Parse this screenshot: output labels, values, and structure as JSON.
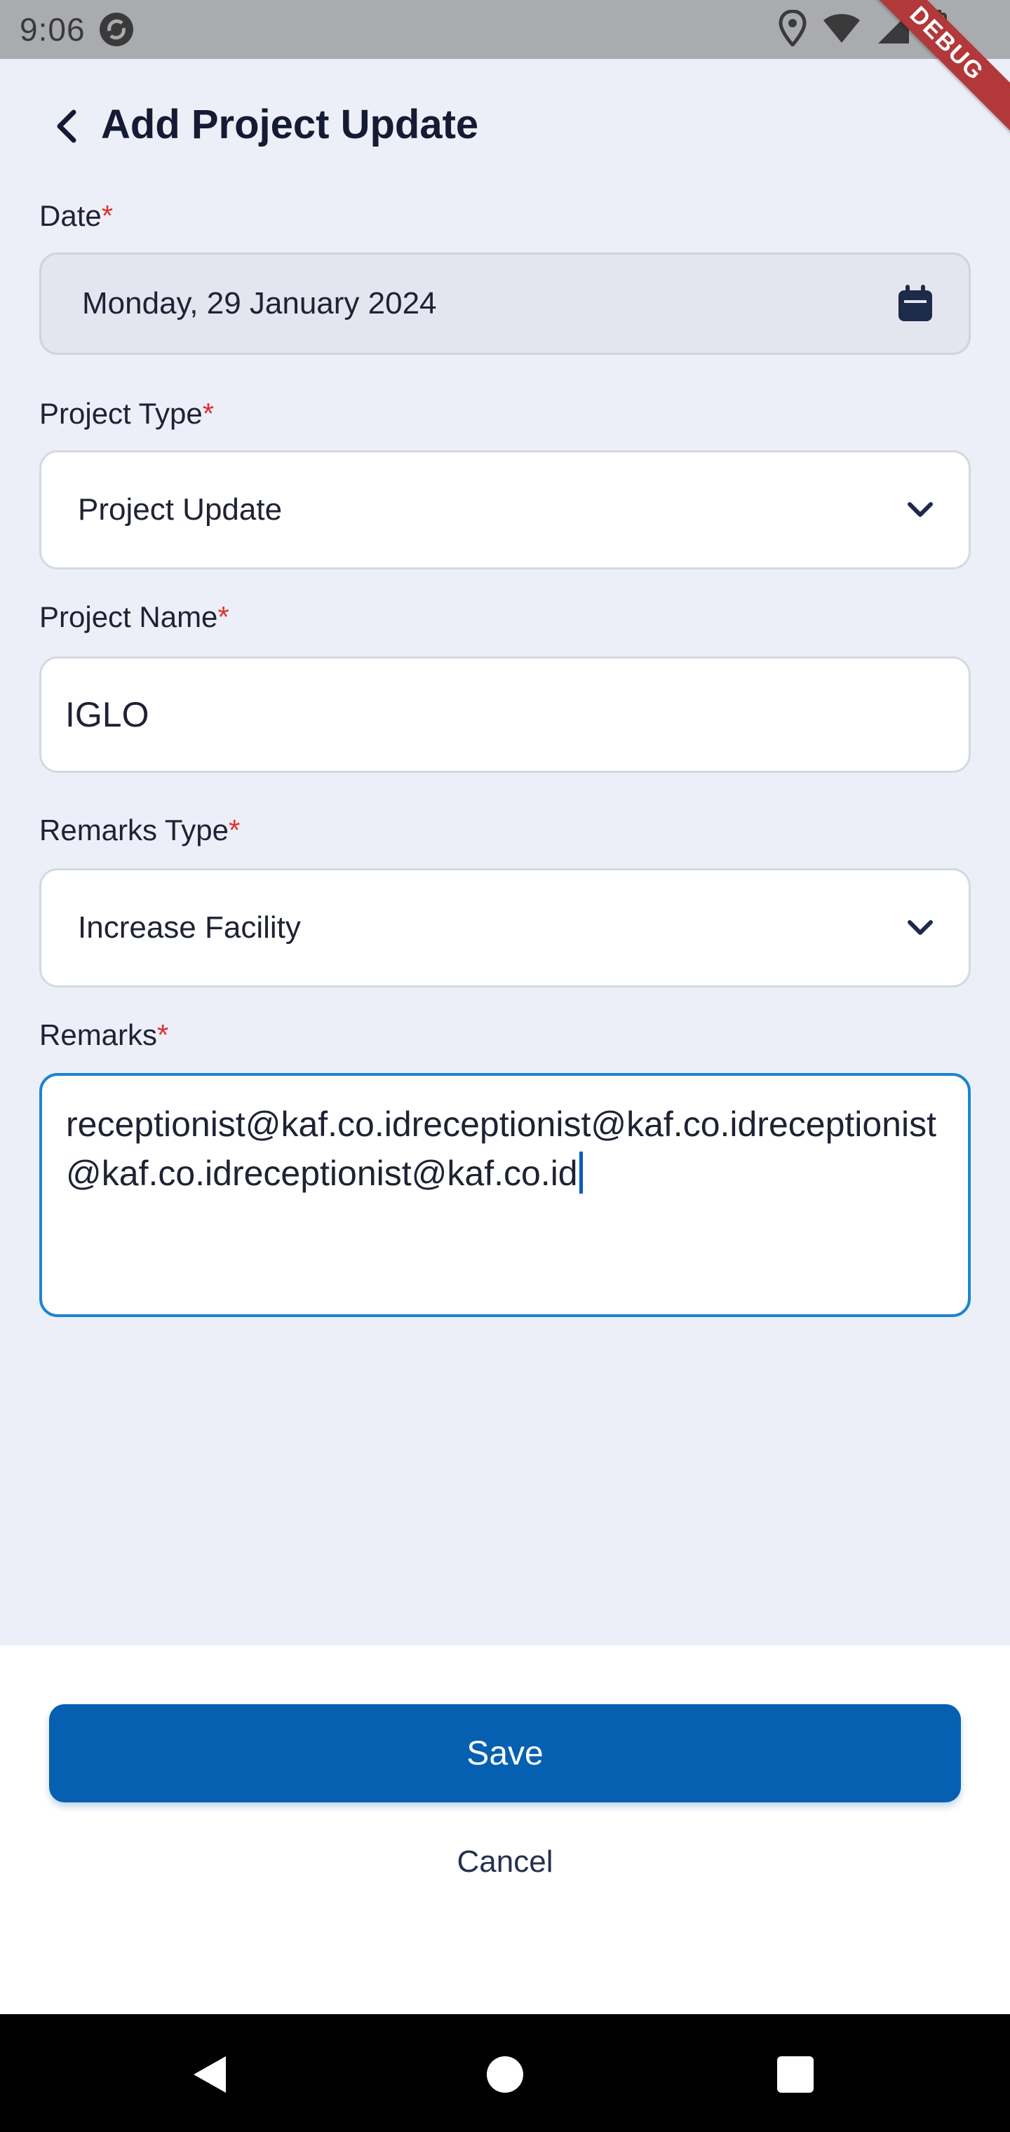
{
  "status_bar": {
    "time": "9:06",
    "debug_label": "DEBUG"
  },
  "header": {
    "title": "Add Project Update"
  },
  "form": {
    "date": {
      "label": "Date",
      "required_mark": "*",
      "value": "Monday, 29 January 2024"
    },
    "project_type": {
      "label": "Project Type",
      "required_mark": "*",
      "value": "Project Update"
    },
    "project_name": {
      "label": "Project Name",
      "required_mark": "*",
      "value": "IGLO"
    },
    "remarks_type": {
      "label": "Remarks Type",
      "required_mark": "*",
      "value": "Increase Facility"
    },
    "remarks": {
      "label": "Remarks",
      "required_mark": "*",
      "value": "receptionist@kaf.co.idreceptionist@kaf.co.idreceptionist@kaf.co.idreceptionist@kaf.co.id"
    }
  },
  "actions": {
    "save_label": "Save",
    "cancel_label": "Cancel"
  },
  "colors": {
    "primary": "#0660B1",
    "focus_border": "#1C84D0",
    "required": "#E0312D",
    "background": "#ECEFF7"
  }
}
